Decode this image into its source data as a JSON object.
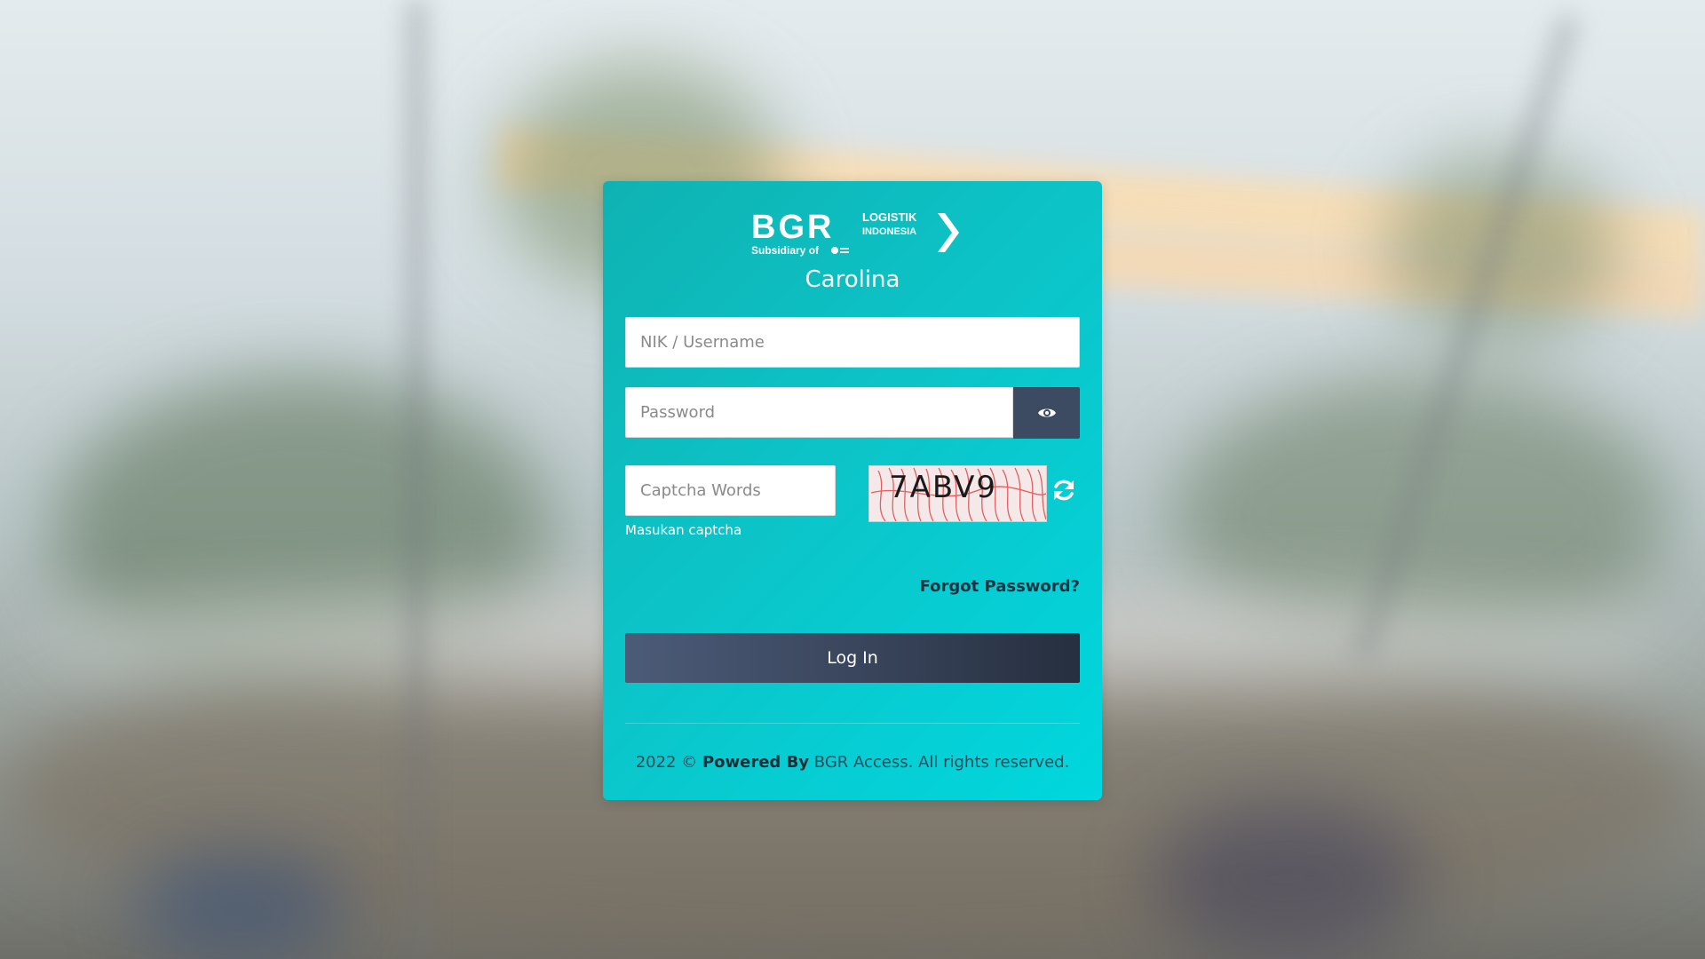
{
  "brand": {
    "logo_main": "BGR",
    "logo_line1": "LOGISTIK",
    "logo_line2": "INDONESIA",
    "logo_sub": "Subsidiary of",
    "app_name": "Carolina"
  },
  "form": {
    "username_placeholder": "NIK / Username",
    "password_placeholder": "Password",
    "captcha_placeholder": "Captcha Words",
    "captcha_hint": "Masukan captcha",
    "captcha_text": "7ABV9",
    "forgot_label": "Forgot Password?",
    "login_label": "Log In"
  },
  "footer": {
    "year": "2022 ©",
    "powered_by": "Powered By",
    "suffix": "BGR Access. All rights reserved."
  },
  "icons": {
    "password_toggle": "eye-icon",
    "captcha_refresh": "refresh-icon"
  },
  "colors": {
    "card_start": "#0fb2b2",
    "card_end": "#00d7de",
    "login_button": "#3a465d",
    "eye_button": "#3c4a62"
  }
}
